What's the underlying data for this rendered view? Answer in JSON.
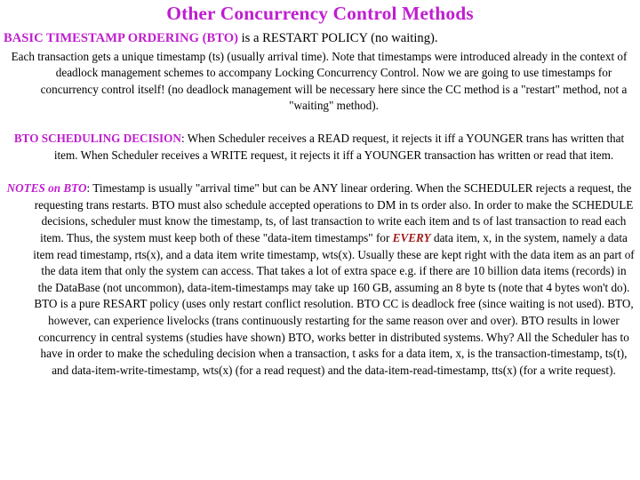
{
  "slide": {
    "title": "Other Concurrency Control Methods",
    "title_color": "#bf1ecf",
    "accent_color": "#bf1ecf",
    "emphasis_color": "#9e1b1b",
    "background_color": "#ffffff",
    "text_color": "#000000"
  },
  "blocks": {
    "intro": {
      "heading": "BASIC TIMESTAMP ORDERING (BTO)",
      "heading_rest": " is a RESTART POLICY (no waiting).",
      "body": "Each transaction gets a unique timestamp (ts) (usually arrival time).  Note that timestamps were introduced already in the context of deadlock management schemes to accompany Locking Concurrency Control. Now we are going to use timestamps for concurrency control itself! (no deadlock management will be necessary here since the CC method is a \"restart\" method, not a \"waiting\" method)."
    },
    "scheduling": {
      "heading": "BTO SCHEDULING DECISION",
      "body": ": When Scheduler receives a READ request, it rejects it iff a YOUNGER trans has written that item. When Scheduler receives a WRITE request, it rejects it iff a YOUNGER transaction has written or read that item."
    },
    "notes": {
      "heading": "NOTES on BTO",
      "body_part1": ": Timestamp is usually \"arrival time\" but can be ANY linear ordering. When the SCHEDULER rejects a request, the requesting trans restarts. BTO must also schedule accepted operations to DM in ts order also. In order to make the SCHEDULE decisions, scheduler must know the timestamp, ts, of last transaction to write each item and ts of last transaction to read each item. Thus, the system must keep both of these \"data-item timestamps\" for ",
      "emphasis": "EVERY",
      "body_part2": " data item, x, in the system, namely a data item read timestamp, rts(x), and a data item write timestamp, wts(x). Usually these are kept right with the data item as an part of the data item that only the system can access.  That takes a lot of extra space e.g. if there are 10 billion data items (records) in the DataBase (not uncommon), data-item-timestamps may take up 160 GB, assuming an 8 byte ts (note that 4 bytes won't do).  BTO is a pure RESART policy (uses only restart conflict resolution.  BTO CC is deadlock free (since waiting is not used). BTO, however, can experience livelocks (trans continuously restarting for the same reason over and over).  BTO results in lower concurrency in central systems (studies have shown)  BTO, works better in distributed systems.  Why?  All the Scheduler has to have in order to make the scheduling decision when a transaction, t asks for a data item, x, is the transaction-timestamp, ts(t), and data-item-write-timestamp, wts(x) (for a read request) and the data-item-read-timestamp, tts(x) (for a write request)."
    }
  }
}
